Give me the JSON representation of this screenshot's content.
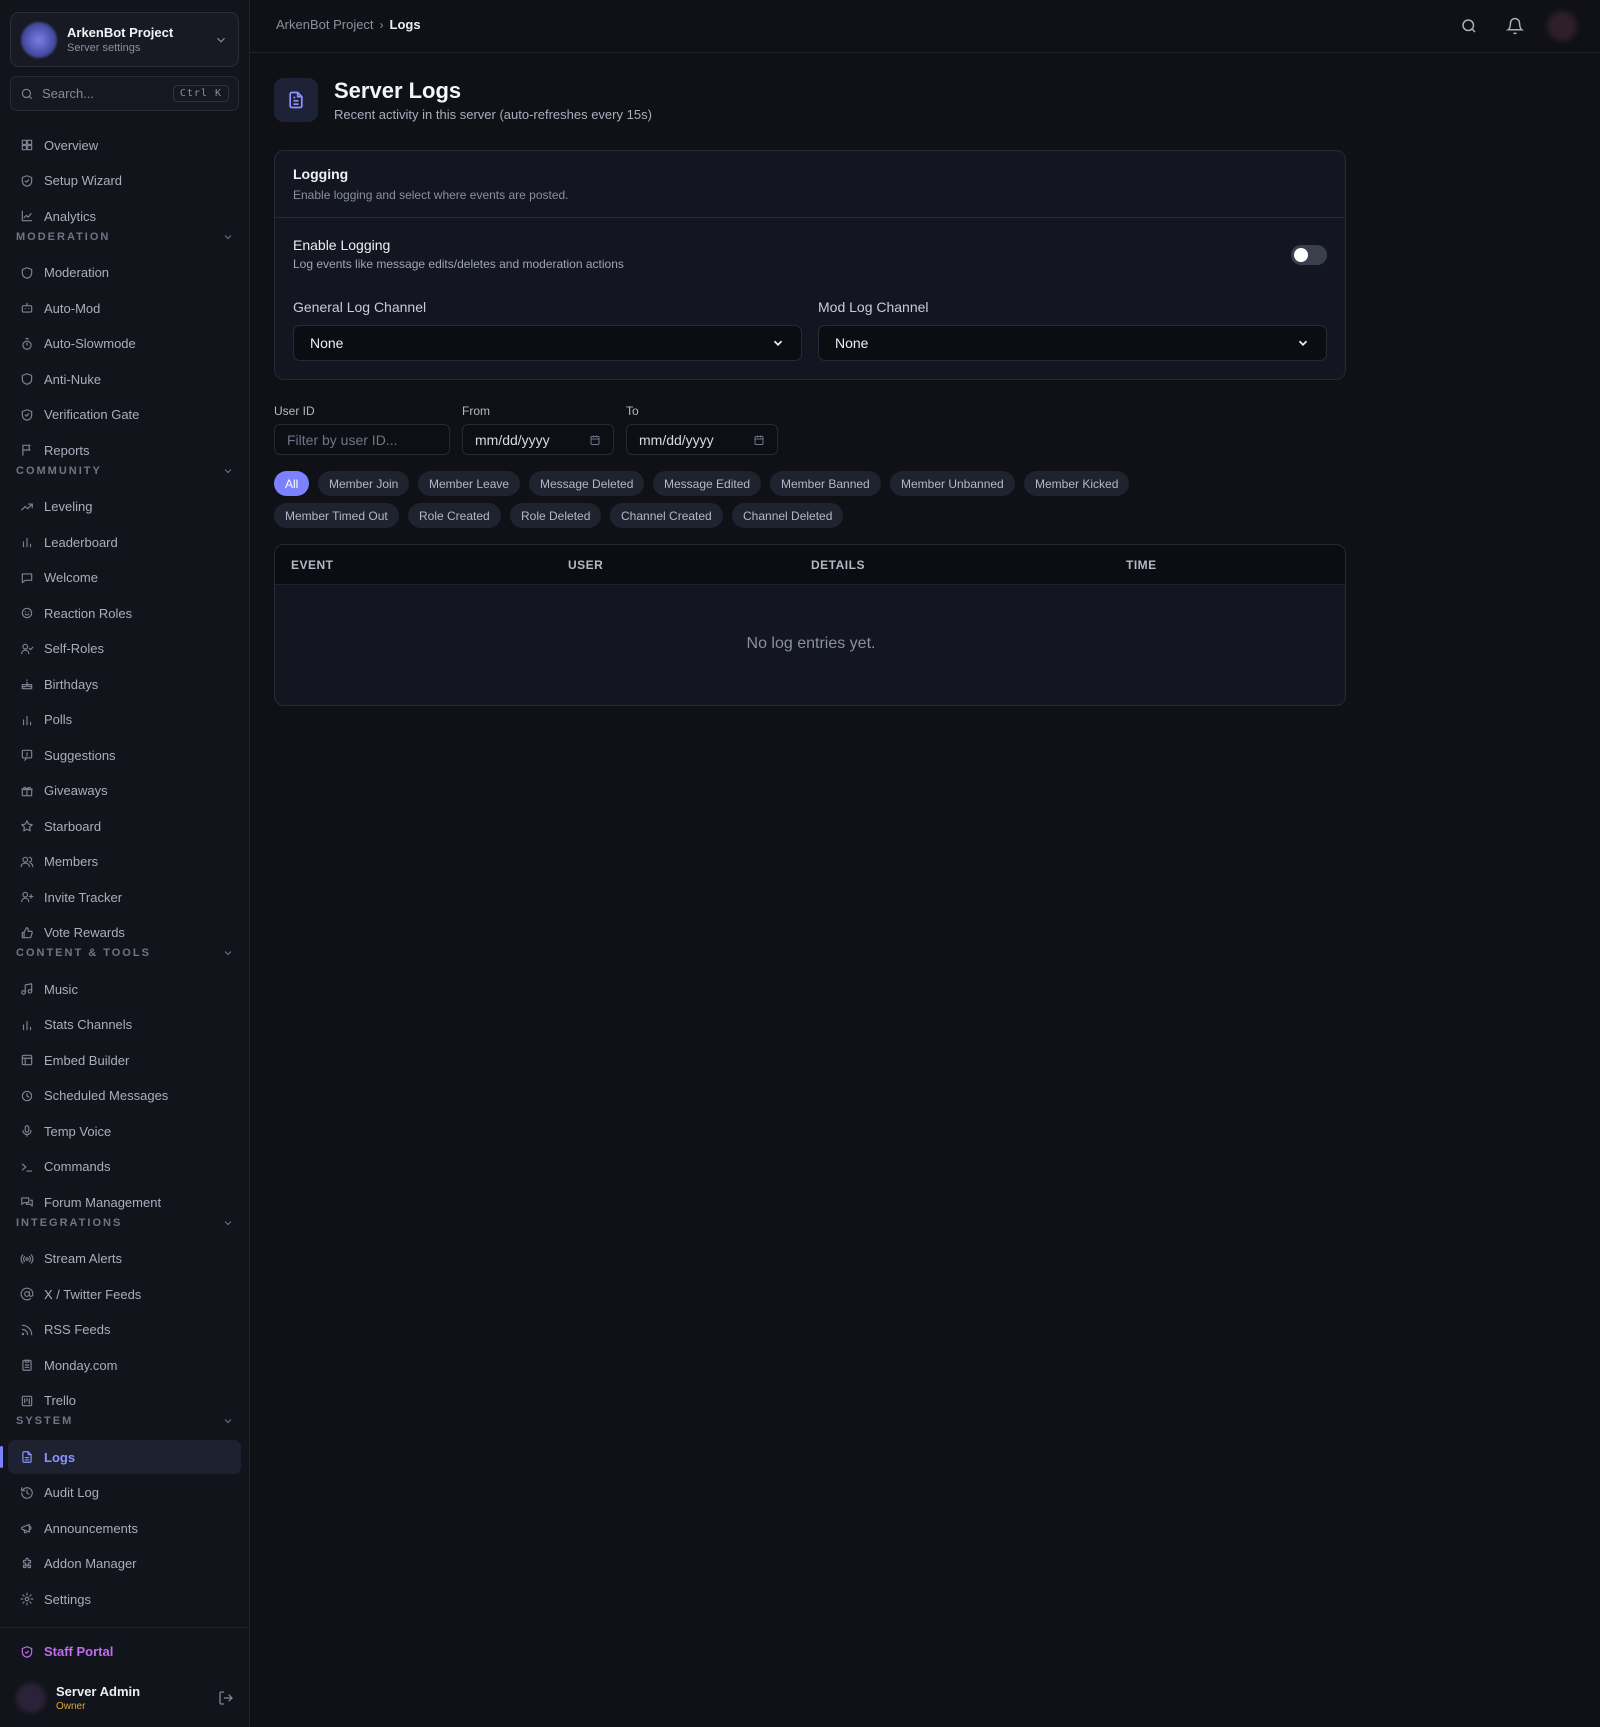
{
  "server": {
    "name": "ArkenBot Project",
    "subtitle": "Server settings"
  },
  "search": {
    "placeholder": "Search...",
    "shortcut": "Ctrl K"
  },
  "nav": {
    "top": [
      {
        "label": "Overview",
        "icon": "grid-icon"
      },
      {
        "label": "Setup Wizard",
        "icon": "shield-check-icon"
      },
      {
        "label": "Analytics",
        "icon": "chart-line-icon"
      }
    ],
    "sections": [
      {
        "title": "MODERATION",
        "items": [
          {
            "label": "Moderation",
            "icon": "shield-icon"
          },
          {
            "label": "Auto-Mod",
            "icon": "bot-icon"
          },
          {
            "label": "Auto-Slowmode",
            "icon": "timer-icon"
          },
          {
            "label": "Anti-Nuke",
            "icon": "shield-icon"
          },
          {
            "label": "Verification Gate",
            "icon": "shield-check-icon"
          },
          {
            "label": "Reports",
            "icon": "flag-icon"
          }
        ]
      },
      {
        "title": "COMMUNITY",
        "items": [
          {
            "label": "Leveling",
            "icon": "trending-up-icon"
          },
          {
            "label": "Leaderboard",
            "icon": "bar-chart-icon"
          },
          {
            "label": "Welcome",
            "icon": "message-icon"
          },
          {
            "label": "Reaction Roles",
            "icon": "smile-icon"
          },
          {
            "label": "Self-Roles",
            "icon": "user-check-icon"
          },
          {
            "label": "Birthdays",
            "icon": "cake-icon"
          },
          {
            "label": "Polls",
            "icon": "bar-chart-icon"
          },
          {
            "label": "Suggestions",
            "icon": "message-square-icon"
          },
          {
            "label": "Giveaways",
            "icon": "gift-icon"
          },
          {
            "label": "Starboard",
            "icon": "star-icon"
          },
          {
            "label": "Members",
            "icon": "users-icon"
          },
          {
            "label": "Invite Tracker",
            "icon": "user-plus-icon"
          },
          {
            "label": "Vote Rewards",
            "icon": "thumbs-up-icon"
          }
        ]
      },
      {
        "title": "CONTENT & TOOLS",
        "items": [
          {
            "label": "Music",
            "icon": "music-icon"
          },
          {
            "label": "Stats Channels",
            "icon": "bar-chart-icon"
          },
          {
            "label": "Embed Builder",
            "icon": "layout-icon"
          },
          {
            "label": "Scheduled Messages",
            "icon": "clock-icon"
          },
          {
            "label": "Temp Voice",
            "icon": "mic-icon"
          },
          {
            "label": "Commands",
            "icon": "terminal-icon"
          },
          {
            "label": "Forum Management",
            "icon": "messages-icon"
          }
        ]
      },
      {
        "title": "INTEGRATIONS",
        "items": [
          {
            "label": "Stream Alerts",
            "icon": "radio-icon"
          },
          {
            "label": "X / Twitter Feeds",
            "icon": "at-sign-icon"
          },
          {
            "label": "RSS Feeds",
            "icon": "rss-icon"
          },
          {
            "label": "Monday.com",
            "icon": "clipboard-icon"
          },
          {
            "label": "Trello",
            "icon": "kanban-icon"
          }
        ]
      },
      {
        "title": "SYSTEM",
        "items": [
          {
            "label": "Logs",
            "icon": "file-text-icon",
            "active": true
          },
          {
            "label": "Audit Log",
            "icon": "history-icon"
          },
          {
            "label": "Announcements",
            "icon": "megaphone-icon"
          },
          {
            "label": "Addon Manager",
            "icon": "puzzle-icon"
          },
          {
            "label": "Settings",
            "icon": "gear-icon"
          }
        ]
      }
    ]
  },
  "footer": {
    "staff_label": "Staff Portal",
    "user_name": "Server Admin",
    "user_role": "Owner"
  },
  "breadcrumb": {
    "parent": "ArkenBot Project",
    "current": "Logs"
  },
  "page": {
    "title": "Server Logs",
    "subtitle": "Recent activity in this server (auto-refreshes every 15s)"
  },
  "logging_card": {
    "title": "Logging",
    "description": "Enable logging and select where events are posted.",
    "toggle_title": "Enable Logging",
    "toggle_description": "Log events like message edits/deletes and moderation actions",
    "enabled": false,
    "general_label": "General Log Channel",
    "general_value": "None",
    "mod_label": "Mod Log Channel",
    "mod_value": "None"
  },
  "filters": {
    "user_label": "User ID",
    "user_placeholder": "Filter by user ID...",
    "from_label": "From",
    "from_value": "mm/dd/yyyy",
    "to_label": "To",
    "to_value": "mm/dd/yyyy"
  },
  "chips": [
    "All",
    "Member Join",
    "Member Leave",
    "Message Deleted",
    "Message Edited",
    "Member Banned",
    "Member Unbanned",
    "Member Kicked",
    "Member Timed Out",
    "Role Created",
    "Role Deleted",
    "Channel Created",
    "Channel Deleted"
  ],
  "table": {
    "columns": [
      "EVENT",
      "USER",
      "DETAILS",
      "TIME"
    ],
    "empty_text": "No log entries yet."
  },
  "colors": {
    "accent": "#7c82ff",
    "staff": "#c06cf0",
    "owner": "#e0a33a",
    "background": "#0f1117"
  }
}
